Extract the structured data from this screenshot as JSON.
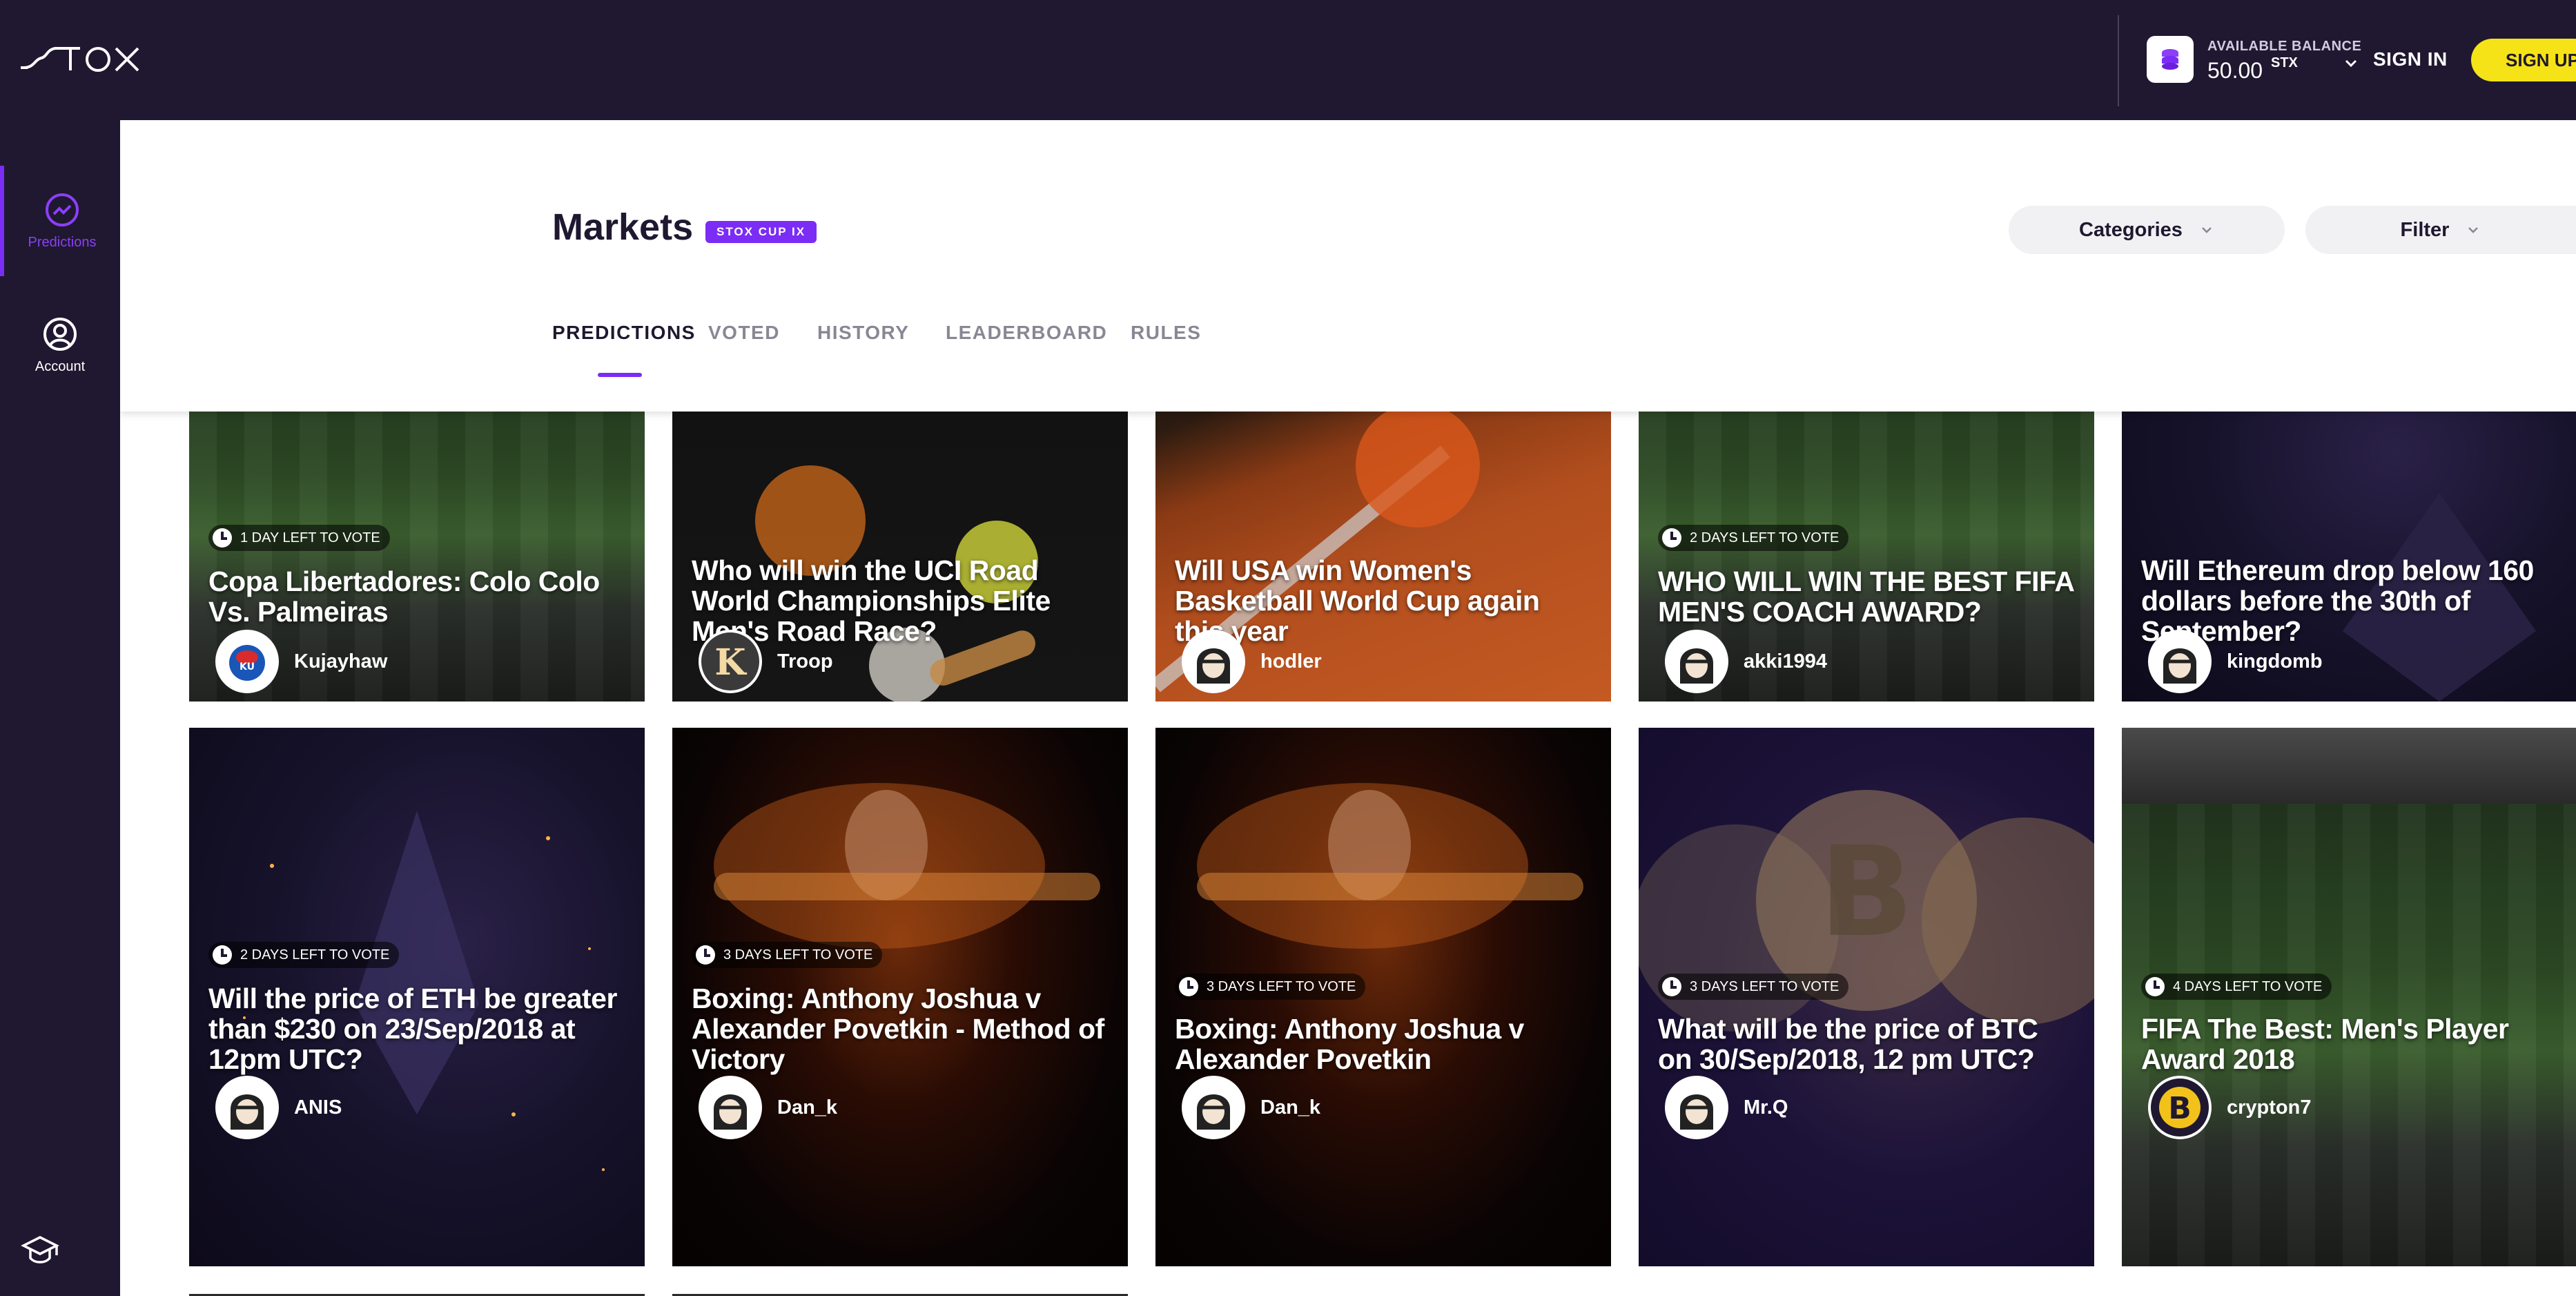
{
  "topbar": {
    "logo": "STOX",
    "balance_label": "AVAILABLE BALANCE",
    "balance_value": "50.00",
    "balance_unit": "STX",
    "signin": "SIGN IN",
    "signup": "SIGN UP"
  },
  "sidebar": {
    "items": [
      {
        "label": "Predictions",
        "icon": "trend-chart-icon"
      },
      {
        "label": "Account",
        "icon": "user-icon"
      }
    ]
  },
  "header": {
    "title": "Markets",
    "badge": "STOX CUP IX",
    "categories": "Categories",
    "filter": "Filter",
    "tabs": [
      "PREDICTIONS",
      "VOTED",
      "HISTORY",
      "LEADERBOARD",
      "RULES"
    ]
  },
  "cards_row1": [
    {
      "timer": "1 DAY LEFT TO VOTE",
      "title": "Copa Libertadores: Colo Colo Vs. Palmeiras",
      "author": "Kujayhaw"
    },
    {
      "timer": "",
      "title": "Who will win the UCI Road World Championships Elite Men's Road Race?",
      "author": "Troop"
    },
    {
      "timer": "",
      "title": "Will USA win Women's Basketball World Cup again this year",
      "author": "hodler"
    },
    {
      "timer": "2 DAYS LEFT TO VOTE",
      "title": "WHO WILL WIN THE BEST FIFA MEN'S COACH AWARD?",
      "author": "akki1994"
    },
    {
      "timer": "",
      "title": "Will Ethereum drop below 160 dollars before the 30th of September?",
      "author": "kingdomb"
    }
  ],
  "cards_row2": [
    {
      "timer": "2 DAYS LEFT TO VOTE",
      "title": "Will the price of ETH be greater than $230 on 23/Sep/2018 at 12pm UTC?",
      "author": "ANIS"
    },
    {
      "timer": "3 DAYS LEFT TO VOTE",
      "title": "Boxing: Anthony Joshua v Alexander Povetkin - Method of Victory",
      "author": "Dan_k"
    },
    {
      "timer": "3 DAYS LEFT TO VOTE",
      "title": "Boxing: Anthony Joshua v Alexander Povetkin",
      "author": "Dan_k"
    },
    {
      "timer": "3 DAYS LEFT TO VOTE",
      "title": "What will be the price of BTC on 30/Sep/2018, 12 pm UTC?",
      "author": "Mr.Q"
    },
    {
      "timer": "4 DAYS LEFT TO VOTE",
      "title": "FIFA The Best: Men's Player Award 2018",
      "author": "crypton7"
    }
  ],
  "colors": {
    "navy": "#1f1830",
    "accent": "#7b2cf5",
    "signup": "#f6e317"
  }
}
